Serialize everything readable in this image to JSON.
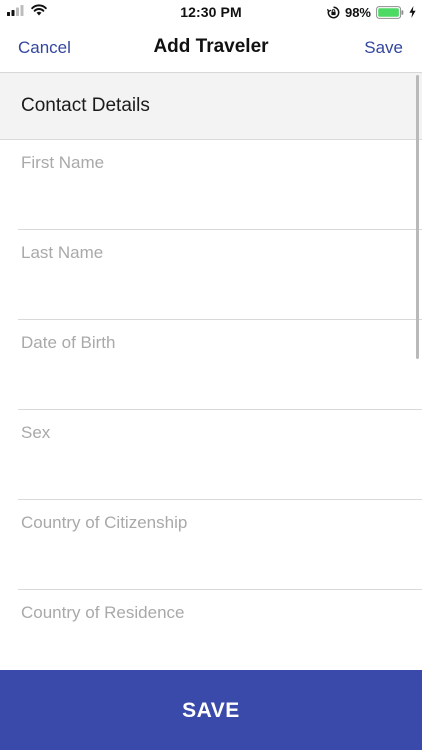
{
  "status_bar": {
    "time": "12:30 PM",
    "battery_percent": "98%",
    "battery_level": 0.98,
    "icons": [
      "signal-icon",
      "wifi-icon",
      "orientation-lock-icon",
      "battery-icon",
      "charging-bolt-icon"
    ]
  },
  "nav": {
    "cancel_label": "Cancel",
    "title": "Add Traveler",
    "save_label": "Save"
  },
  "section": {
    "title": "Contact Details"
  },
  "fields": [
    {
      "label": "First Name",
      "value": ""
    },
    {
      "label": "Last Name",
      "value": ""
    },
    {
      "label": "Date of Birth",
      "value": ""
    },
    {
      "label": "Sex",
      "value": ""
    },
    {
      "label": "Country of Citizenship",
      "value": ""
    },
    {
      "label": "Country of Residence",
      "value": ""
    }
  ],
  "footer": {
    "save_button_label": "SAVE"
  },
  "colors": {
    "accent": "#33479f",
    "save_bar": "#3a4aab",
    "section_bg": "#f3f3f3",
    "placeholder": "#a9a9a9",
    "battery_fill": "#4cd964"
  }
}
